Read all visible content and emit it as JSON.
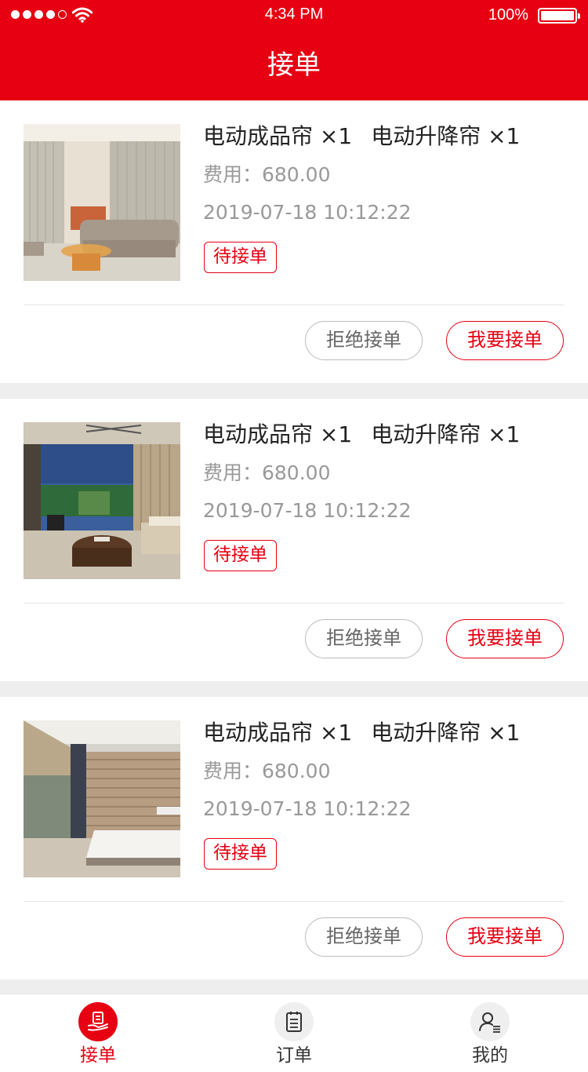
{
  "status_bar": {
    "time": "4:34 PM",
    "battery": "100%",
    "battery_level": 1.0,
    "signal_bars": 4
  },
  "header": {
    "title": "接单"
  },
  "colors": {
    "accent": "#e60012",
    "muted_text": "#999999",
    "background": "#eeeeee"
  },
  "orders": [
    {
      "items": [
        "电动成品帘 ×1",
        "电动升降帘 ×1"
      ],
      "fee": "费用：680.00",
      "date": "2019-07-18 10:12:22",
      "status": "待接单",
      "reject_label": "拒绝接单",
      "accept_label": "我要接单",
      "image": "living-room-curtains"
    },
    {
      "items": [
        "电动成品帘 ×1",
        "电动升降帘 ×1"
      ],
      "fee": "费用：680.00",
      "date": "2019-07-18 10:12:22",
      "status": "待接单",
      "reject_label": "拒绝接单",
      "accept_label": "我要接单",
      "image": "terrace-lounge"
    },
    {
      "items": [
        "电动成品帘 ×1",
        "电动升降帘 ×1"
      ],
      "fee": "费用：680.00",
      "date": "2019-07-18 10:12:22",
      "status": "待接单",
      "reject_label": "拒绝接单",
      "accept_label": "我要接单",
      "image": "bedroom-blinds"
    }
  ],
  "tabbar": [
    {
      "label": "接单",
      "icon": "hand-document-icon",
      "active": true
    },
    {
      "label": "订单",
      "icon": "list-document-icon",
      "active": false
    },
    {
      "label": "我的",
      "icon": "user-profile-icon",
      "active": false
    }
  ]
}
